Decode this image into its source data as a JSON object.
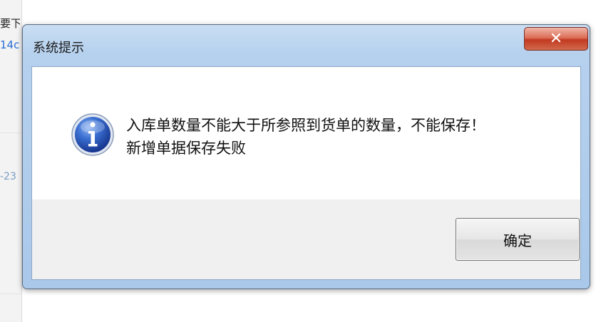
{
  "background_page": {
    "left_fragments": [
      "要下载",
      "14c",
      "-23"
    ]
  },
  "dialog": {
    "title": "系统提示",
    "close_label": "✕",
    "icon": "info-icon",
    "message_line1": "入库单数量不能大于所参照到货单的数量，不能保存！",
    "message_line2": "新增单据保存失败",
    "ok_label": "确定"
  }
}
